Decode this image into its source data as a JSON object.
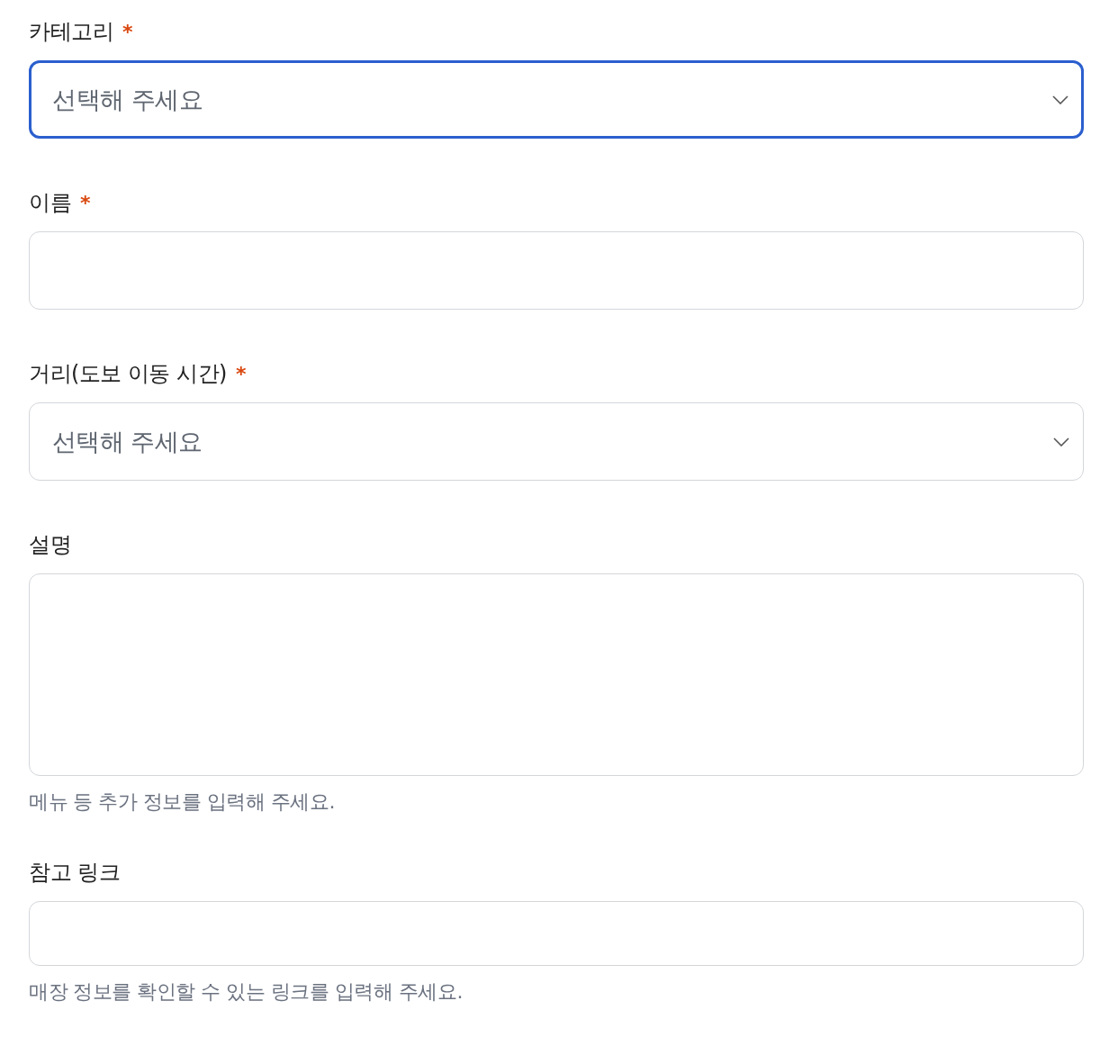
{
  "fields": [
    {
      "kind": "select",
      "label": "카테고리",
      "required_mark": "*",
      "placeholder": "선택해 주세요",
      "focused": true
    },
    {
      "kind": "input",
      "label": "이름",
      "required_mark": "*",
      "focused": false
    },
    {
      "kind": "select",
      "label": "거리(도보 이동 시간)",
      "required_mark": "*",
      "placeholder": "선택해 주세요",
      "focused": false
    },
    {
      "kind": "textarea",
      "label": "설명",
      "helper": "메뉴 등 추가 정보를 입력해 주세요.",
      "focused": false
    },
    {
      "kind": "link",
      "label": "참고 링크",
      "helper": "매장 정보를 확인할 수 있는 링크를 입력해 주세요.",
      "focused": false
    }
  ]
}
